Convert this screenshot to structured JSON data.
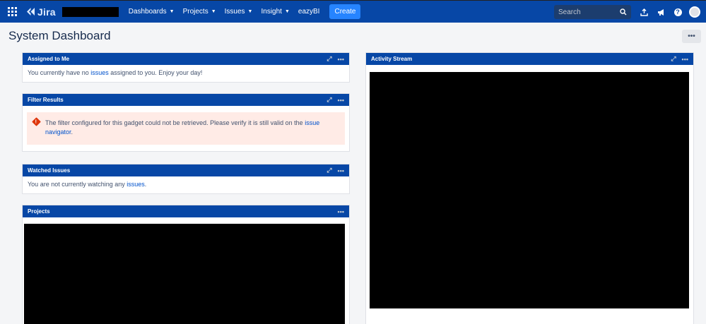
{
  "nav": {
    "logo_text": "Jira",
    "menu": [
      {
        "label": "Dashboards"
      },
      {
        "label": "Projects"
      },
      {
        "label": "Issues"
      },
      {
        "label": "Insight"
      },
      {
        "label": "eazyBI"
      }
    ],
    "create_label": "Create",
    "search_placeholder": "Search"
  },
  "page": {
    "title": "System Dashboard",
    "tools_label": "•••"
  },
  "gadgets": {
    "assigned": {
      "title": "Assigned to Me",
      "text_before": "You currently have no ",
      "link": "issues",
      "text_after": " assigned to you. Enjoy your day!"
    },
    "filter": {
      "title": "Filter Results",
      "error_text": "The filter configured for this gadget could not be retrieved. Please verify it is still valid on the ",
      "link": "issue navigator",
      "text_after": "."
    },
    "watched": {
      "title": "Watched Issues",
      "text_before": "You are not currently watching any ",
      "link": "issues",
      "text_after": "."
    },
    "projects": {
      "title": "Projects"
    },
    "activity": {
      "title": "Activity Stream"
    }
  },
  "icons": {
    "expand": "expand-icon",
    "more": "more-icon"
  },
  "colors": {
    "nav_bg": "#0747a6",
    "create_bg": "#2684ff",
    "error_bg": "#ffebe6",
    "link": "#0052cc"
  }
}
